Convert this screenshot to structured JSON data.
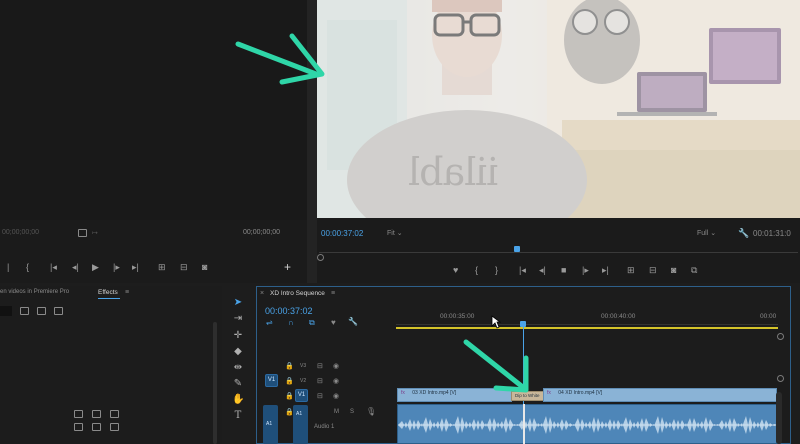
{
  "source_monitor": {
    "timecode_left": "00;00;00;00",
    "timecode_right": "00;00;00;00"
  },
  "program_monitor": {
    "timecode": "00:00:37:02",
    "fit": "Fit",
    "resolution": "Full",
    "duration": "00:01:31:0",
    "shirt_text": "iilabl"
  },
  "project_panel": {
    "tab_partial": "en videos in Premiere Pro",
    "tab_effects": "Effects"
  },
  "timeline": {
    "sequence_name": "XD Intro Sequence",
    "timecode": "00:00:37:02",
    "ruler": [
      "00:00:35:00",
      "00:00:40:00",
      "00:00"
    ],
    "tracks": {
      "v3": "V3",
      "v2": "V2",
      "v1": "V1",
      "a1": "A1",
      "v1_src": "V1",
      "a1_src": "A1",
      "audio_name": "Audio 1",
      "m": "M",
      "s": "S"
    },
    "clips": {
      "clip1": "03 XD Intro.mp4 [V]",
      "transition": "Dip to White",
      "clip2": "04 XD Intro.mp4 [V]"
    }
  },
  "colors": {
    "accent": "#4aa3e8",
    "arrow": "#2fd6a8",
    "work_area": "#d4c32a",
    "clip_video": "#8ab3d6"
  }
}
